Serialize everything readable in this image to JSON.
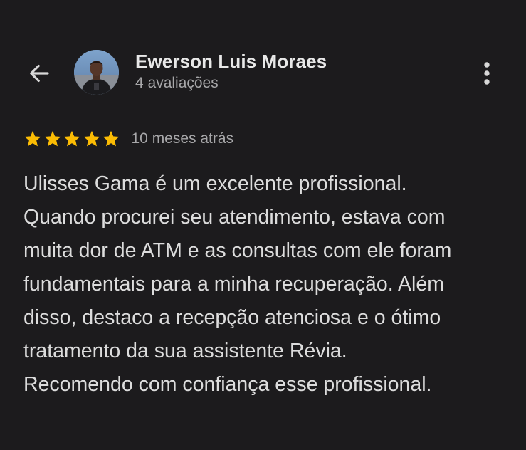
{
  "header": {
    "back_icon": "arrow-left-icon",
    "menu_icon": "more-vertical-icon"
  },
  "reviewer": {
    "name": "Ewerson Luis Moraes",
    "reviews_count": "4 avaliações"
  },
  "review": {
    "rating": 5,
    "rating_max": 5,
    "date": "10 meses atrás",
    "text_lines": [
      "Ulisses Gama é um excelente profissional.",
      "Quando procurei seu atendimento, estava com",
      "muita dor de ATM e as consultas com ele foram",
      "fundamentais para a minha recuperação. Além",
      "disso, destaco a recepção atenciosa e o ótimo",
      "tratamento da sua assistente Révia.",
      "Recomendo com confiança esse profissional."
    ]
  },
  "colors": {
    "background": "#1c1b1d",
    "star": "#fbbc04",
    "primary_text": "#e3e3e3",
    "secondary_text": "#a7a7a9"
  }
}
